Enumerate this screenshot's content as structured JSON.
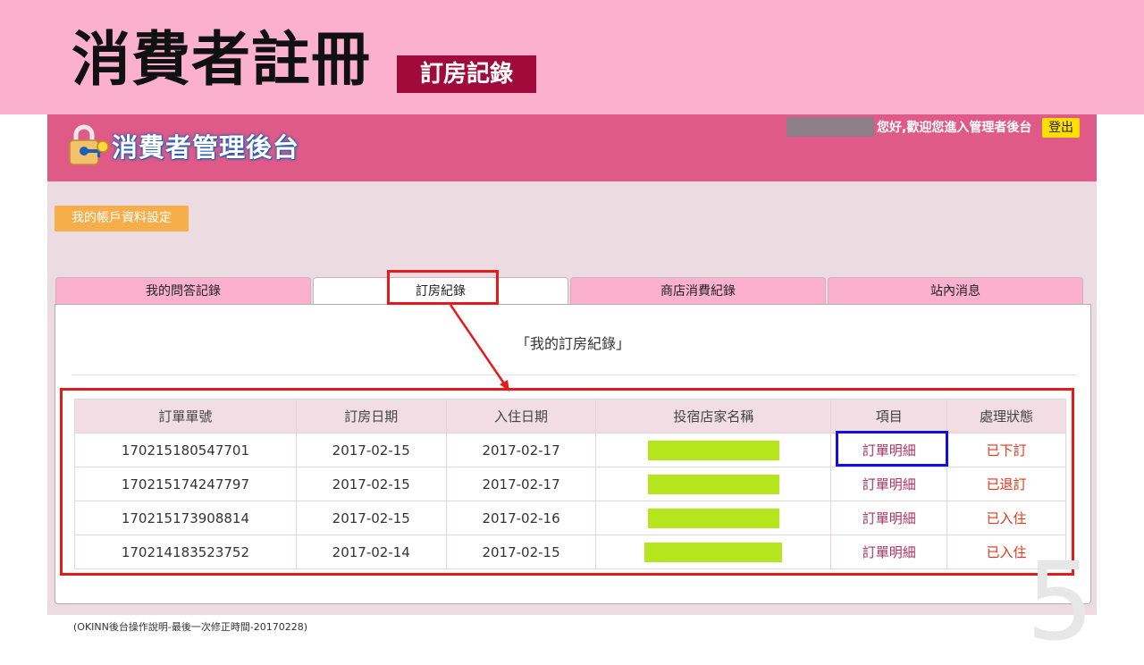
{
  "slide": {
    "title": "消費者註冊",
    "subtitle": "訂房記錄",
    "page_number": "5",
    "footer_note": "(OKINN後台操作說明-最後一次修正時間-20170228)"
  },
  "header": {
    "logo_text": "消費者管理後台",
    "logo_icon": "padlock-key-icon",
    "welcome": "您好,歡迎您進入管理者後台",
    "logout_label": "登出"
  },
  "account_button": "我的帳戶資料設定",
  "tabs": [
    {
      "label": "我的問答記錄",
      "active": false
    },
    {
      "label": "訂房紀錄",
      "active": true
    },
    {
      "label": "商店消費紀錄",
      "active": false
    },
    {
      "label": "站內消息",
      "active": false
    }
  ],
  "panel": {
    "heading": "「我的訂房紀錄」"
  },
  "table": {
    "headers": [
      "訂單單號",
      "訂房日期",
      "入住日期",
      "投宿店家名稱",
      "項目",
      "處理狀態"
    ],
    "rows": [
      {
        "order_no": "170215180547701",
        "booking_date": "2017-02-15",
        "checkin_date": "2017-02-17",
        "detail": "訂單明細",
        "status": "已下訂"
      },
      {
        "order_no": "170215174247797",
        "booking_date": "2017-02-15",
        "checkin_date": "2017-02-17",
        "detail": "訂單明細",
        "status": "已退訂"
      },
      {
        "order_no": "170215173908814",
        "booking_date": "2017-02-15",
        "checkin_date": "2017-02-16",
        "detail": "訂單明細",
        "status": "已入住"
      },
      {
        "order_no": "170214183523752",
        "booking_date": "2017-02-14",
        "checkin_date": "2017-02-15",
        "detail": "訂單明細",
        "status": "已入住"
      }
    ]
  },
  "colors": {
    "banner": "#fbb0cb",
    "header": "#e05a87",
    "highlight_red": "#e51b1b",
    "highlight_blue": "#1010e0",
    "mask_green": "#b5e61d"
  }
}
